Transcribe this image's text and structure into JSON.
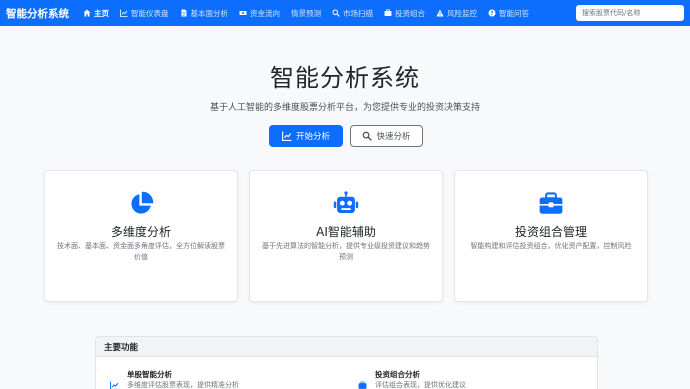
{
  "navbar": {
    "brand": "智能分析系统",
    "items": [
      {
        "label": "主页",
        "icon": "home-icon"
      },
      {
        "label": "智能仪表盘",
        "icon": "chart-line-icon"
      },
      {
        "label": "基本面分析",
        "icon": "file-icon"
      },
      {
        "label": "资金流向",
        "icon": "money-icon"
      },
      {
        "label": "情景预测",
        "icon": "none"
      },
      {
        "label": "市场扫描",
        "icon": "search-icon"
      },
      {
        "label": "投资组合",
        "icon": "briefcase-icon"
      },
      {
        "label": "风险监控",
        "icon": "warning-icon"
      },
      {
        "label": "智能问答",
        "icon": "question-icon"
      }
    ],
    "search_placeholder": "搜索股票代码/名称",
    "accent_color": "#0d6efd"
  },
  "hero": {
    "title": "智能分析系统",
    "subtitle": "基于人工智能的多维度股票分析平台，为您提供专业的投资决策支持",
    "primary_button": "开始分析",
    "secondary_button": "快速分析"
  },
  "features": [
    {
      "title": "多维度分析",
      "description": "技术面、基本面、资金面多角度评估，全方位解读股票价值",
      "icon": "pie-chart-icon"
    },
    {
      "title": "AI智能辅助",
      "description": "基于先进算法的智能分析，提供专业级投资建议和趋势预测",
      "icon": "robot-icon"
    },
    {
      "title": "投资组合管理",
      "description": "智能构建和评估投资组合，优化资产配置，控制风险",
      "icon": "briefcase-icon"
    }
  ],
  "main_functions": {
    "title": "主要功能",
    "items": [
      {
        "title": "单股智能分析",
        "description": "多维度评估股票表现，提供精准分析",
        "icon": "chart-line-icon"
      },
      {
        "title": "投资组合分析",
        "description": "评估组合表现，提供优化建议",
        "icon": "briefcase-icon"
      }
    ]
  }
}
